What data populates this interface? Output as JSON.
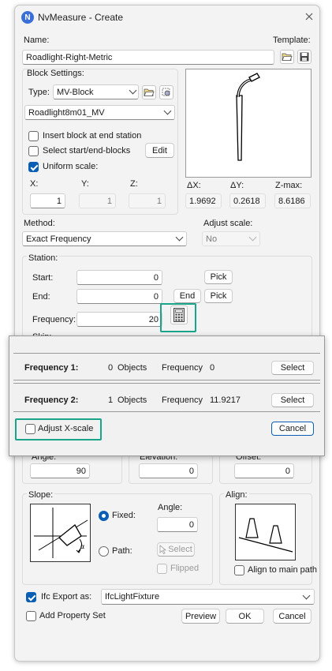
{
  "title": "NvMeasure - Create",
  "logo_letter": "N",
  "name_label": "Name:",
  "name_value": "Roadlight-Right-Metric",
  "template_label": "Template:",
  "block": {
    "group_label": "Block Settings:",
    "type_label": "Type:",
    "type_value": "MV-Block",
    "block_value": "Roadlight8m01_MV",
    "insert_label": "Insert block at end station",
    "select_label": "Select start/end-blocks",
    "edit_label": "Edit",
    "uniform_label": "Uniform scale:",
    "x_label": "X:",
    "y_label": "Y:",
    "z_label": "Z:",
    "x_value": "1",
    "y_value": "1",
    "z_value": "1"
  },
  "dims": {
    "dx_label": "ΔX:",
    "dy_label": "ΔY:",
    "zmax_label": "Z-max:",
    "dx_value": "1.9692",
    "dy_value": "0.2618",
    "zmax_value": "8.6186"
  },
  "method": {
    "label": "Method:",
    "value": "Exact Frequency",
    "adjust_label": "Adjust scale:",
    "adjust_value": "No"
  },
  "station": {
    "label": "Station:",
    "start_label": "Start:",
    "start_value": "0",
    "end_label": "End:",
    "end_value": "0",
    "end_button": "End",
    "pick_label": "Pick",
    "frequency_label": "Frequency:",
    "frequency_value": "20",
    "skip_label": "Skip:"
  },
  "popup": {
    "f1_label": "Frequency 1:",
    "f1_count": "0",
    "f2_label": "Frequency 2:",
    "f2_count": "1",
    "objects_label": "Objects",
    "frequency_word": "Frequency",
    "f1_value": "0",
    "f2_value": "11.9217",
    "select_label": "Select",
    "adjust_x_label": "Adjust X-scale",
    "cancel_label": "Cancel"
  },
  "placement": {
    "angle_label": "Angle:",
    "elevation_label": "Elevation:",
    "offset_label": "Offset:",
    "angle_value": "90",
    "elevation_value": "0",
    "offset_value": "0"
  },
  "slope": {
    "label": "Slope:",
    "fixed_label": "Fixed:",
    "path_label": "Path:",
    "angle_label": "Angle:",
    "angle_value": "0",
    "select_label": "Select",
    "flipped_label": "Flipped"
  },
  "align": {
    "label": "Align:",
    "main_path_label": "Align to main path"
  },
  "ifc": {
    "export_label": "Ifc Export as:",
    "export_value": "IfcLightFixture",
    "property_label": "Add Property Set"
  },
  "buttons": {
    "preview": "Preview",
    "ok": "OK",
    "cancel": "Cancel"
  },
  "colors": {
    "accent": "#0a5fb4",
    "highlight": "#19a58a",
    "logo": "#3a6fd8"
  }
}
